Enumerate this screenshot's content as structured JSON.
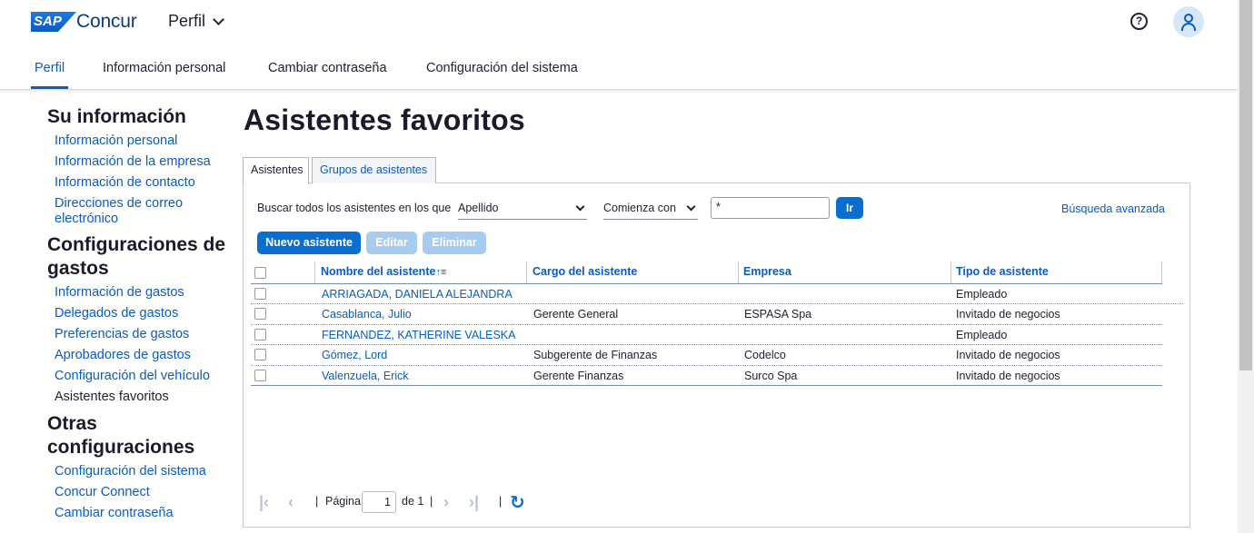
{
  "header": {
    "logo_sap": "SAP",
    "logo_name": "Concur",
    "profile_menu": "Perfil",
    "help_glyph": "?"
  },
  "navtabs": [
    "Perfil",
    "Información personal",
    "Cambiar contraseña",
    "Configuración del sistema"
  ],
  "sidebar": {
    "sections": [
      {
        "heading": "Su información",
        "links": [
          "Información personal",
          "Información de la empresa",
          "Información de contacto",
          "Direcciones de correo electrónico"
        ]
      },
      {
        "heading": "Configuraciones de gastos",
        "links": [
          "Información de gastos",
          "Delegados de gastos",
          "Preferencias de gastos",
          "Aprobadores de gastos",
          "Configuración del vehículo",
          "Asistentes favoritos"
        ]
      },
      {
        "heading": "Otras configuraciones",
        "links": [
          "Configuración del sistema",
          "Concur Connect",
          "Cambiar contraseña"
        ]
      }
    ],
    "current": "Asistentes favoritos"
  },
  "main": {
    "title": "Asistentes favoritos",
    "subtabs": [
      "Asistentes",
      "Grupos de asistentes"
    ],
    "search": {
      "label": "Buscar todos los asistentes en los que",
      "field": "Apellido",
      "operator": "Comienza con",
      "value": "*",
      "go": "Ir",
      "advanced": "Búsqueda avanzada"
    },
    "buttons": {
      "new": "Nuevo asistente",
      "edit": "Editar",
      "delete": "Eliminar"
    },
    "table": {
      "headers": [
        "Nombre del asistente",
        "Cargo del asistente",
        "Empresa",
        "Tipo de asistente"
      ],
      "sort_glyph": "↑≡",
      "rows": [
        [
          "ARRIAGADA, DANIELA ALEJANDRA",
          "",
          "",
          "Empleado"
        ],
        [
          "Casablanca, Julio",
          "Gerente General",
          "ESPASA Spa",
          "Invitado de negocios"
        ],
        [
          "FERNANDEZ, KATHERINE VALESKA",
          "",
          "",
          "Empleado"
        ],
        [
          "Gómez, Lord",
          "Subgerente de Finanzas",
          "Codelco",
          "Invitado de negocios"
        ],
        [
          "Valenzuela, Erick",
          "Gerente Finanzas",
          "Surco Spa",
          "Invitado de negocios"
        ]
      ]
    },
    "pager": {
      "page_label": "Página",
      "page": "1",
      "of_label": "de 1"
    }
  }
}
